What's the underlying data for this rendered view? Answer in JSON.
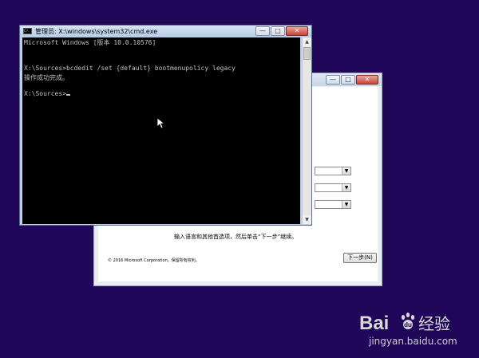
{
  "cmd": {
    "title": "管理员: X:\\windows\\system32\\cmd.exe",
    "icon": "cmd-icon",
    "lines": [
      "Microsoft Windows [版本 10.0.10576]",
      "",
      "X:\\Sources>bcdedit /set {default} bootmenupolicy legacy",
      "操作成功完成。",
      "",
      "X:\\Sources>"
    ],
    "controls": {
      "minimize": "—",
      "maximize": "□",
      "close": "✕"
    }
  },
  "setup": {
    "instruction": "输入语言和其他首选项，然后单击“下一步”继续。",
    "copyright": "© 2016 Microsoft Corporation。保留所有权利。",
    "next_button": "下一步(N)",
    "controls": {
      "minimize": "—",
      "maximize": "□",
      "close": "✕"
    }
  },
  "watermark": {
    "brand": "Bai",
    "brand_cn": "经验",
    "url": "jingyan.baidu.com"
  },
  "colors": {
    "desktop": "#21075a",
    "console_bg": "#000000",
    "console_text": "#c0c0c0"
  }
}
